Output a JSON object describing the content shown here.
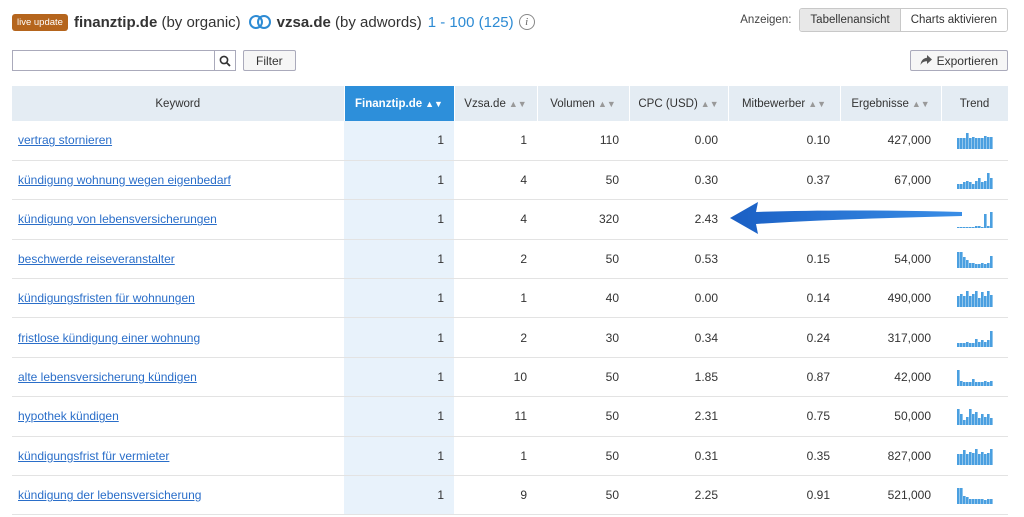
{
  "header": {
    "badge": "live update",
    "domain1": "finanztip.de",
    "domain1_suffix": "(by organic)",
    "domain2": "vzsa.de",
    "domain2_suffix": "(by adwords)",
    "range": "1 - 100 (125)",
    "info": "i"
  },
  "view": {
    "label": "Anzeigen:",
    "table_view": "Tabellenansicht",
    "charts": "Charts aktivieren"
  },
  "search": {
    "value": "",
    "placeholder": ""
  },
  "filter_label": "Filter",
  "export_label": "Exportieren",
  "columns": {
    "keyword": "Keyword",
    "finanztip": "Finanztip.de",
    "vzsa": "Vzsa.de",
    "volume": "Volumen",
    "cpc": "CPC (USD)",
    "competitors": "Mitbewerber",
    "results": "Ergebnisse",
    "trend": "Trend"
  },
  "rows": [
    {
      "keyword": "vertrag stornieren",
      "finanztip": "1",
      "vzsa": "1",
      "volume": "110",
      "cpc": "0.00",
      "competitors": "0.10",
      "results": "427,000",
      "trend": [
        8,
        8,
        8,
        12,
        8,
        9,
        8,
        8,
        8,
        10,
        9,
        9
      ]
    },
    {
      "keyword": "kündigung wohnung wegen eigenbedarf",
      "finanztip": "1",
      "vzsa": "4",
      "volume": "50",
      "cpc": "0.30",
      "competitors": "0.37",
      "results": "67,000",
      "trend": [
        4,
        4,
        5,
        6,
        5,
        4,
        6,
        8,
        5,
        6,
        12,
        8
      ]
    },
    {
      "keyword": "kündigung von lebensversicherungen",
      "finanztip": "1",
      "vzsa": "4",
      "volume": "320",
      "cpc": "2.43",
      "competitors": "",
      "results": "",
      "trend": [
        1,
        1,
        1,
        1,
        1,
        1,
        2,
        2,
        1,
        12,
        2,
        14
      ]
    },
    {
      "keyword": "beschwerde reiseveranstalter",
      "finanztip": "1",
      "vzsa": "2",
      "volume": "50",
      "cpc": "0.53",
      "competitors": "0.15",
      "results": "54,000",
      "trend": [
        12,
        12,
        8,
        6,
        4,
        4,
        3,
        3,
        4,
        3,
        4,
        9
      ]
    },
    {
      "keyword": "kündigungsfristen für wohnungen",
      "finanztip": "1",
      "vzsa": "1",
      "volume": "40",
      "cpc": "0.00",
      "competitors": "0.14",
      "results": "490,000",
      "trend": [
        8,
        10,
        8,
        12,
        8,
        10,
        12,
        7,
        11,
        8,
        12,
        9
      ]
    },
    {
      "keyword": "fristlose kündigung einer wohnung",
      "finanztip": "1",
      "vzsa": "2",
      "volume": "30",
      "cpc": "0.34",
      "competitors": "0.24",
      "results": "317,000",
      "trend": [
        3,
        3,
        3,
        4,
        3,
        3,
        6,
        4,
        5,
        4,
        5,
        12
      ]
    },
    {
      "keyword": "alte lebensversicherung kündigen",
      "finanztip": "1",
      "vzsa": "10",
      "volume": "50",
      "cpc": "1.85",
      "competitors": "0.87",
      "results": "42,000",
      "trend": [
        12,
        4,
        3,
        3,
        3,
        5,
        3,
        3,
        3,
        4,
        3,
        4
      ]
    },
    {
      "keyword": "hypothek kündigen",
      "finanztip": "1",
      "vzsa": "11",
      "volume": "50",
      "cpc": "2.31",
      "competitors": "0.75",
      "results": "50,000",
      "trend": [
        12,
        8,
        4,
        6,
        12,
        8,
        10,
        5,
        8,
        6,
        8,
        5
      ]
    },
    {
      "keyword": "kündigungsfrist für vermieter",
      "finanztip": "1",
      "vzsa": "1",
      "volume": "50",
      "cpc": "0.31",
      "competitors": "0.35",
      "results": "827,000",
      "trend": [
        8,
        8,
        11,
        8,
        10,
        9,
        12,
        8,
        10,
        8,
        9,
        12
      ]
    },
    {
      "keyword": "kündigung der lebensversicherung",
      "finanztip": "1",
      "vzsa": "9",
      "volume": "50",
      "cpc": "2.25",
      "competitors": "0.91",
      "results": "521,000",
      "trend": [
        12,
        12,
        6,
        5,
        4,
        4,
        4,
        4,
        4,
        3,
        4,
        4
      ]
    }
  ],
  "colors": {
    "accent": "#2d8fda",
    "link": "#2a6ec9",
    "badge": "#b5651d",
    "trend": "#4a9fe0"
  }
}
